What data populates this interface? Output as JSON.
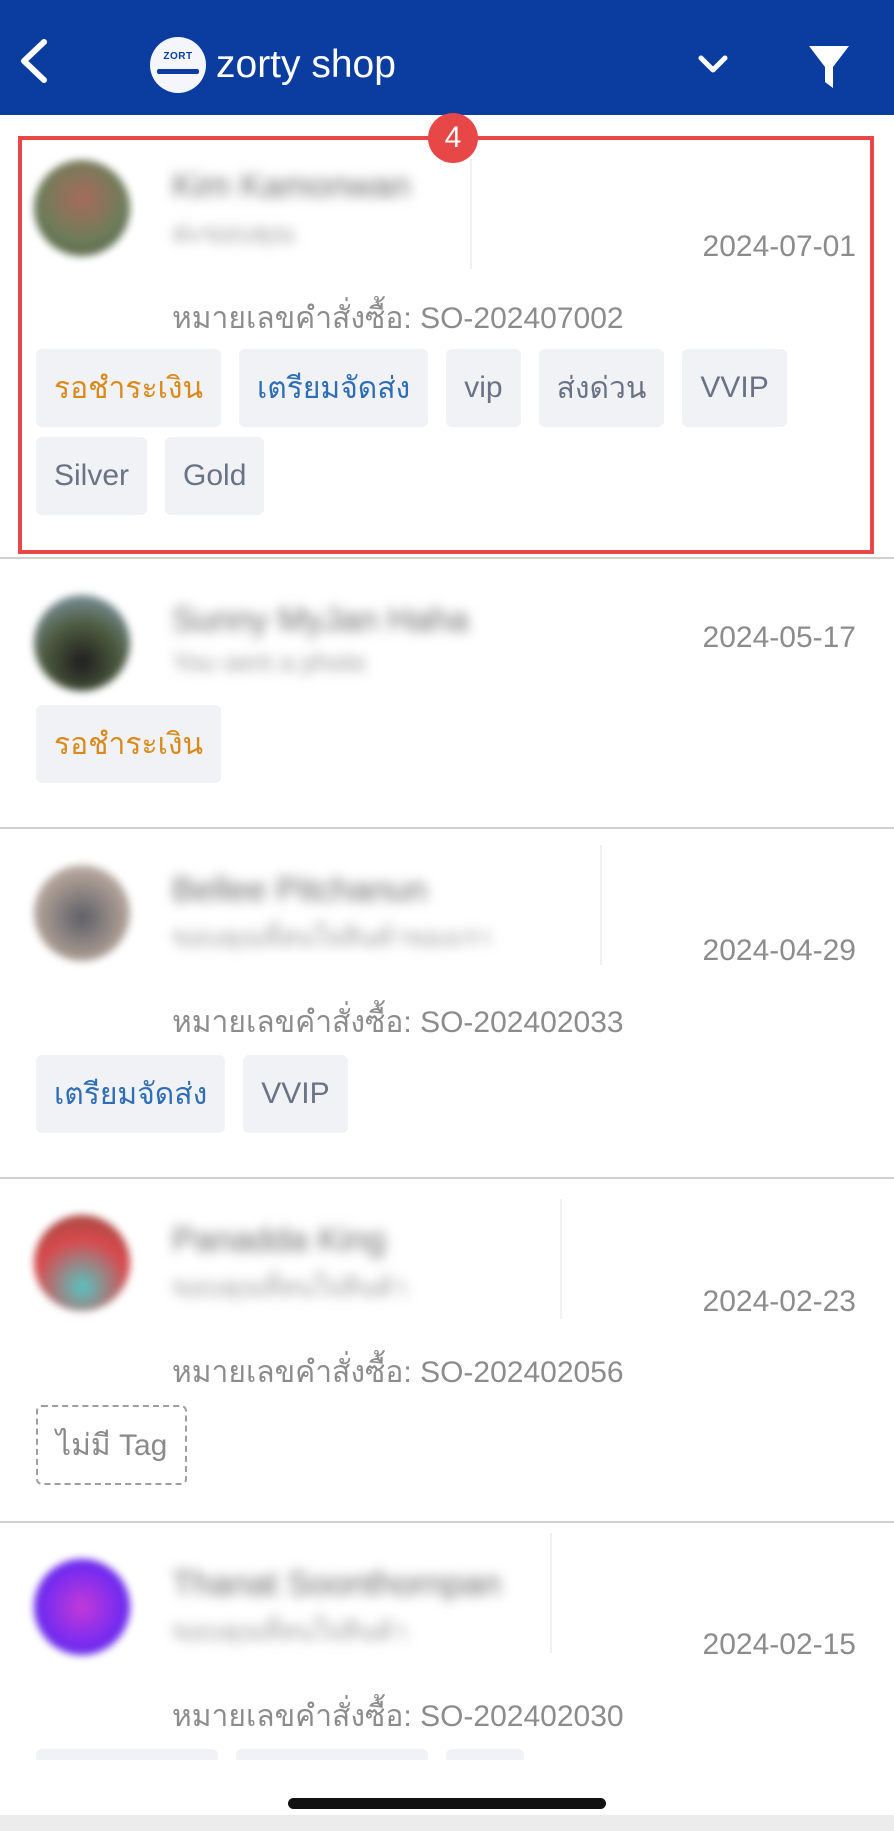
{
  "header": {
    "shop_name": "zorty shop",
    "logo_text": "ZORT",
    "background_color": "#0a3d9f"
  },
  "order_label": "หมายเลขคำสั่งซื้อ:",
  "orders": [
    {
      "customer_name": "Kim Kamonwan",
      "last_message": "ค่ะขอบคุณ",
      "date": "2024-07-01",
      "order_number": "SO-202407002",
      "tags": [
        "รอชำระเงิน",
        "เตรียมจัดส่ง",
        "vip",
        "ส่งด่วน",
        "VVIP",
        "Silver",
        "Gold"
      ]
    },
    {
      "customer_name": "Sunny MyJan Haha",
      "last_message": "You sent a photo",
      "date": "2024-05-17",
      "tags": [
        "รอชำระเงิน"
      ]
    },
    {
      "customer_name": "Bellee Pitchanun",
      "last_message": "ขอบคุณที่สนใจสินค้าของเรา",
      "date": "2024-04-29",
      "order_number": "SO-202402033",
      "tags": [
        "เตรียมจัดส่ง",
        "VVIP"
      ]
    },
    {
      "customer_name": "Panadda King",
      "last_message": "ขอบคุณที่สนใจสินค้า",
      "date": "2024-02-23",
      "order_number": "SO-202402056",
      "tags": [
        "ไม่มี Tag"
      ]
    },
    {
      "customer_name": "Thanat Soonthornpan",
      "last_message": "ขอบคุณที่สนใจสินค้า",
      "date": "2024-02-15",
      "order_number": "SO-202402030"
    }
  ],
  "annotation": {
    "badge_number": "4",
    "color": "#e84747"
  },
  "colors": {
    "tag_orange": "#d98a1e",
    "tag_blue": "#2f6eb5",
    "tag_default": "#6a7385"
  }
}
